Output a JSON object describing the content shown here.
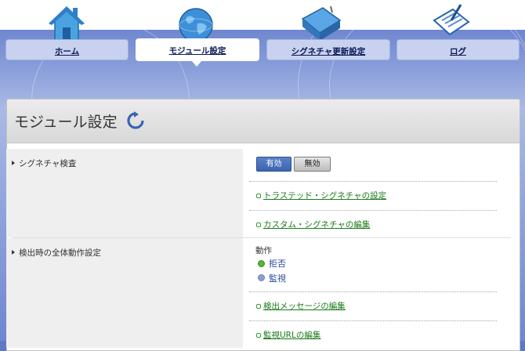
{
  "tabs": [
    {
      "label": "ホーム",
      "icon": "house-icon",
      "active": false
    },
    {
      "label": "モジュール設定",
      "icon": "globe-icon",
      "active": true
    },
    {
      "label": "シグネチャ更新設定",
      "icon": "binder-icon",
      "active": false
    },
    {
      "label": "ログ",
      "icon": "clipboard-icon",
      "active": false
    }
  ],
  "panel": {
    "title": "モジュール設定",
    "refresh_icon": "refresh-icon"
  },
  "signature_check": {
    "label": "シグネチャ検査",
    "enable_label": "有効",
    "disable_label": "無効",
    "selected": "有効",
    "links": [
      "トラステッド・シグネチャの設定",
      "カスタム・シグネチャの編集"
    ]
  },
  "detection_action": {
    "label": "検出時の全体動作設定",
    "action_heading": "動作",
    "options": [
      "拒否",
      "監視"
    ],
    "selected": "拒否",
    "links": [
      "検出メッセージの編集",
      "監視URLの編集"
    ]
  },
  "colors": {
    "accent_blue": "#3b64b2",
    "link_green": "#1c7a1c",
    "radio_selected": "#5bb33a",
    "radio_unselected": "#8f9fd0"
  }
}
